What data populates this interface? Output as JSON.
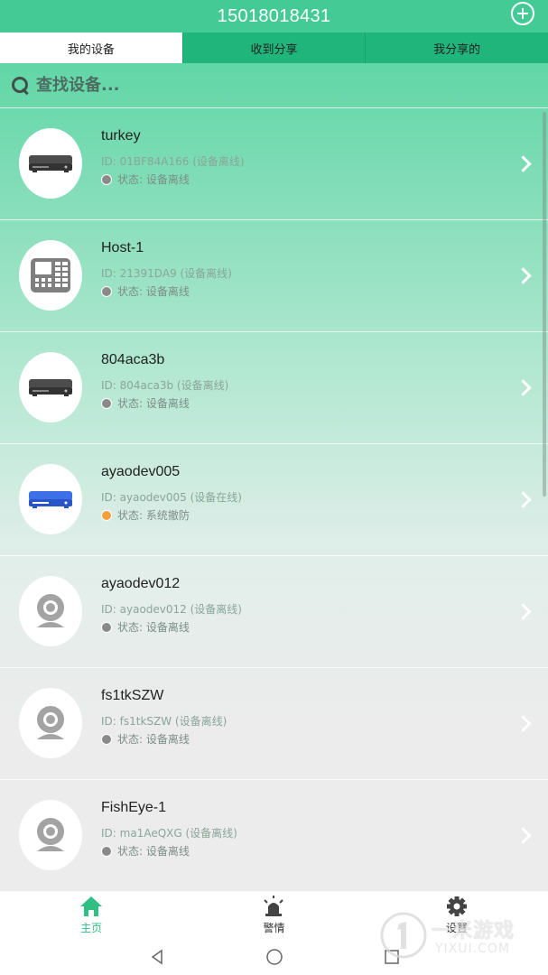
{
  "header": {
    "title": "15018018431"
  },
  "tabs": [
    {
      "label": "我的设备",
      "active": true
    },
    {
      "label": "收到分享",
      "active": false
    },
    {
      "label": "我分享的",
      "active": false
    }
  ],
  "search": {
    "placeholder": "查找设备..."
  },
  "devices": [
    {
      "name": "turkey",
      "id_text": "ID: 01BF84A166 (设备离线)",
      "status_text": "状态: 设备离线",
      "status_color": "#8a8a8a",
      "icon": "dvr-gray-icon"
    },
    {
      "name": "Host-1",
      "id_text": "ID: 21391DA9 (设备离线)",
      "status_text": "状态: 设备离线",
      "status_color": "#8a8a8a",
      "icon": "keypad-host-icon"
    },
    {
      "name": "804aca3b",
      "id_text": "ID: 804aca3b (设备离线)",
      "status_text": "状态: 设备离线",
      "status_color": "#8a8a8a",
      "icon": "dvr-gray-icon"
    },
    {
      "name": "ayaodev005",
      "id_text": "ID: ayaodev005 (设备在线)",
      "status_text": "状态: 系统撤防",
      "status_color": "#f5a03a",
      "icon": "dvr-blue-icon"
    },
    {
      "name": "ayaodev012",
      "id_text": "ID: ayaodev012 (设备离线)",
      "status_text": "状态: 设备离线",
      "status_color": "#8a8a8a",
      "icon": "webcam-icon"
    },
    {
      "name": "fs1tkSZW",
      "id_text": "ID: fs1tkSZW (设备离线)",
      "status_text": "状态: 设备离线",
      "status_color": "#8a8a8a",
      "icon": "webcam-icon"
    },
    {
      "name": "FishEye-1",
      "id_text": "ID: ma1AeQXG (设备离线)",
      "status_text": "状态: 设备离线",
      "status_color": "#8a8a8a",
      "icon": "webcam-icon"
    }
  ],
  "bottom_nav": [
    {
      "label": "主页",
      "icon": "home-icon",
      "active": true
    },
    {
      "label": "警情",
      "icon": "alarm-siren-icon",
      "active": false
    },
    {
      "label": "设置",
      "icon": "gear-icon",
      "active": false
    }
  ],
  "system_nav": [
    "back-icon",
    "home-circle-icon",
    "recents-icon"
  ],
  "watermark": {
    "text_cn": "一米游戏",
    "text_en": "YIXUI.COM"
  },
  "colors": {
    "primary": "#44cb95",
    "tab_bar": "#20b67b",
    "active_nav": "#2fbf85",
    "armed_status": "#f5a03a"
  }
}
